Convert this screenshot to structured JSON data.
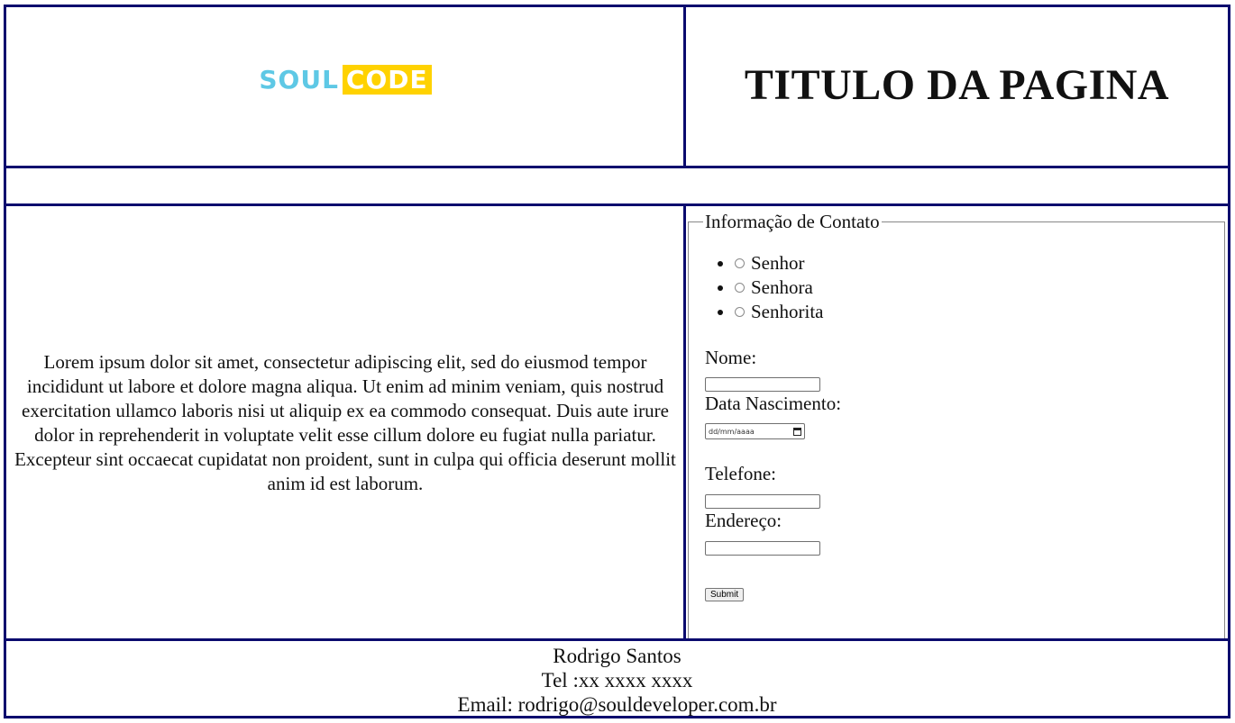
{
  "header": {
    "logo": {
      "part1": "SOUL",
      "part2": "CODE"
    },
    "title": "TITULO DA PAGINA"
  },
  "main": {
    "lorem": "Lorem ipsum dolor sit amet, consectetur adipiscing elit, sed do eiusmod tempor incididunt ut labore et dolore magna aliqua. Ut enim ad minim veniam, quis nostrud exercitation ullamco laboris nisi ut aliquip ex ea commodo consequat. Duis aute irure dolor in reprehenderit in voluptate velit esse cillum dolore eu fugiat nulla pariatur. Excepteur sint occaecat cupidatat non proident, sunt in culpa qui officia deserunt mollit anim id est laborum."
  },
  "form": {
    "legend": "Informação de Contato",
    "titles": [
      "Senhor",
      "Senhora",
      "Senhorita"
    ],
    "nome_label": "Nome:",
    "nome_value": "",
    "nascimento_label": "Data Nascimento:",
    "nascimento_placeholder": "dd/mm/aaaa",
    "telefone_label": "Telefone:",
    "telefone_value": "",
    "endereco_label": "Endereço:",
    "endereco_value": "",
    "submit_label": "Submit"
  },
  "footer": {
    "name": "Rodrigo Santos",
    "phone": "Tel :xx xxxx xxxx",
    "email": "Email: rodrigo@souldeveloper.com.br"
  },
  "colors": {
    "border": "#0b0b6e",
    "logo_cyan": "#5ec8e5",
    "logo_yellow": "#ffd200"
  }
}
